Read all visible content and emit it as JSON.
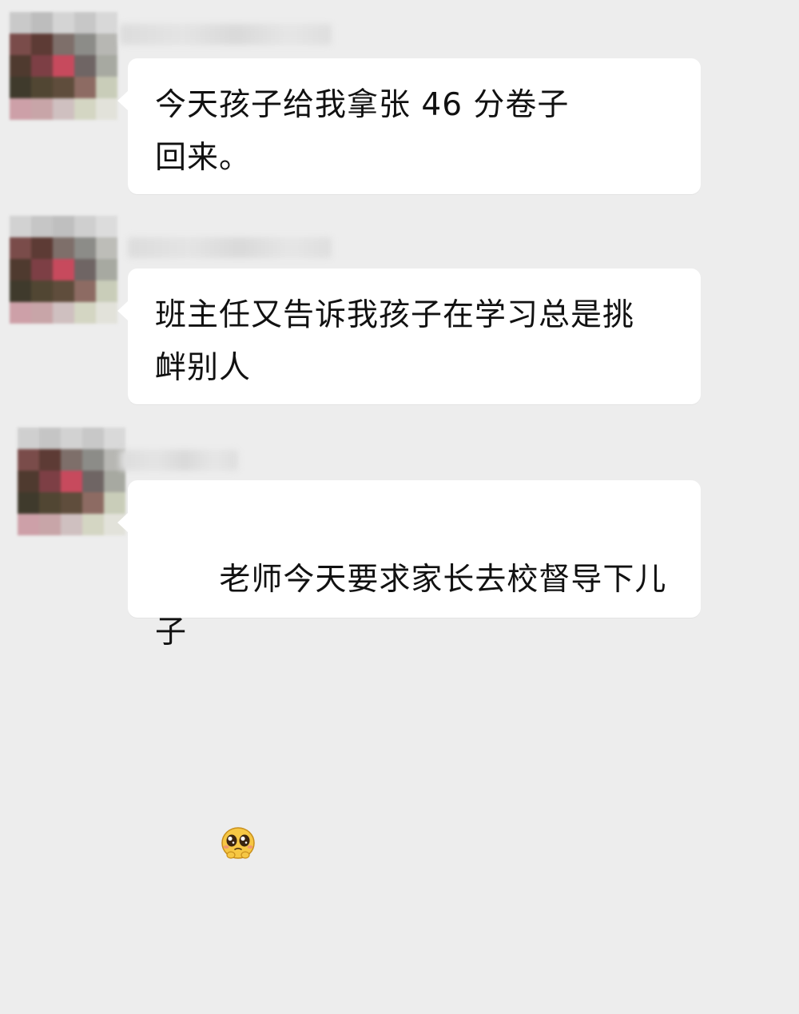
{
  "messages": [
    {
      "text": "今天孩子给我拿张 46 分卷子\n回来。",
      "emoji": ""
    },
    {
      "text": "班主任又告诉我孩子在学习总是挑\n衅别人",
      "emoji": ""
    },
    {
      "text": "老师今天要求家长去校督导下儿子",
      "emoji": "pleading-face-icon"
    }
  ],
  "colors": {
    "background": "#ededed",
    "bubble": "#ffffff",
    "text": "#111111"
  }
}
